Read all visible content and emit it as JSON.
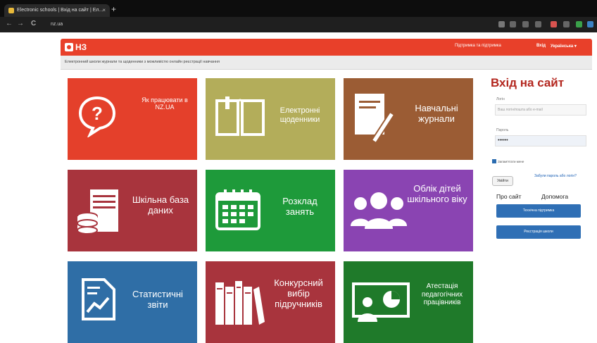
{
  "browser": {
    "tab_title": "Electronic schools | Вхід на сайт | Ел...",
    "tab_close": "×",
    "new_tab": "+",
    "address": "nz.ua",
    "back": "←",
    "forward": "→",
    "reload": "C"
  },
  "header": {
    "logo": "НЗ",
    "link_support": "Підтримка та підтримка",
    "link_login": "Вхід",
    "language": "Українська ▾"
  },
  "breadcrumb": "Електронний школи журнали та щоденники з можливістю онлайн реєстрації навчання",
  "tiles": [
    {
      "label": "Як працювати в NZ.UA",
      "color": "#e4402b",
      "icon": "question-bubble-icon"
    },
    {
      "label": "Електронні щоденники",
      "color": "#b3ad5a",
      "icon": "open-book-icon"
    },
    {
      "label": "Навчальні журнали",
      "color": "#9b5c34",
      "icon": "journal-pen-icon"
    },
    {
      "label": "Шкільна база даних",
      "color": "#a8343d",
      "icon": "database-server-icon"
    },
    {
      "label": "Розклад занять",
      "color": "#1e9a3a",
      "icon": "calendar-icon"
    },
    {
      "label": "Облік дітей шкільного віку",
      "color": "#8a44b2",
      "icon": "people-group-icon"
    },
    {
      "label": "Статистичні звіти",
      "color": "#2f6ea6",
      "icon": "chart-report-icon"
    },
    {
      "label": "Конкурсний вибір підручників",
      "color": "#a8343d",
      "icon": "books-icon"
    },
    {
      "label": "Атестація педагогічних працівників",
      "color": "#1f7a2a",
      "icon": "presentation-icon"
    }
  ],
  "login": {
    "title": "Вхід на сайт",
    "login_label": "Логін",
    "login_placeholder": "Ваш логін/пошта або e-mail",
    "password_label": "Пароль",
    "password_value": "••••••",
    "remember": "Запам'ятати мене",
    "submit": "Увійти",
    "forgot": "Забули пароль або логін?",
    "about": "Про сайт",
    "help": "Допомога",
    "btn_support": "Технічна підтримка",
    "btn_register": "Реєстрація школи"
  },
  "colors": {
    "header_red": "#e8402a",
    "login_title": "#b3261e",
    "button_blue": "#2f6fb5"
  }
}
